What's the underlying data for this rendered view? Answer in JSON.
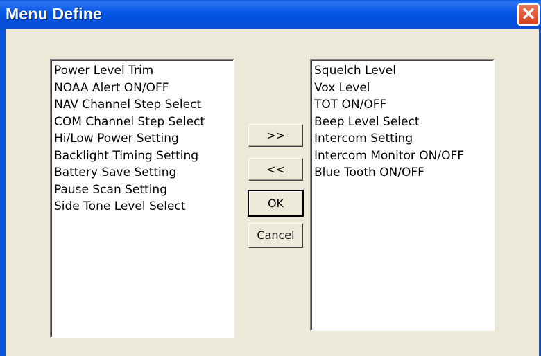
{
  "window": {
    "title": "Menu Define",
    "close_glyph": "✕"
  },
  "available_list": {
    "items": [
      "Power Level Trim",
      "NOAA Alert ON/OFF",
      "NAV Channel Step Select",
      "COM Channel Step Select",
      "Hi/Low Power Setting",
      "Backlight Timing Setting",
      "Battery Save Setting",
      "Pause Scan Setting",
      "Side Tone Level Select"
    ]
  },
  "selected_list": {
    "items": [
      "Squelch Level",
      "Vox Level",
      "TOT ON/OFF",
      "Beep Level Select",
      "Intercom Setting",
      "Intercom Monitor ON/OFF",
      "Blue Tooth ON/OFF"
    ]
  },
  "buttons": {
    "add_label": ">>",
    "remove_label": "<<",
    "ok_label": "OK",
    "cancel_label": "Cancel"
  },
  "colors": {
    "titlebar": "#0555e6",
    "dialog_bg": "#ece9d8",
    "close_button": "#d4421c"
  }
}
